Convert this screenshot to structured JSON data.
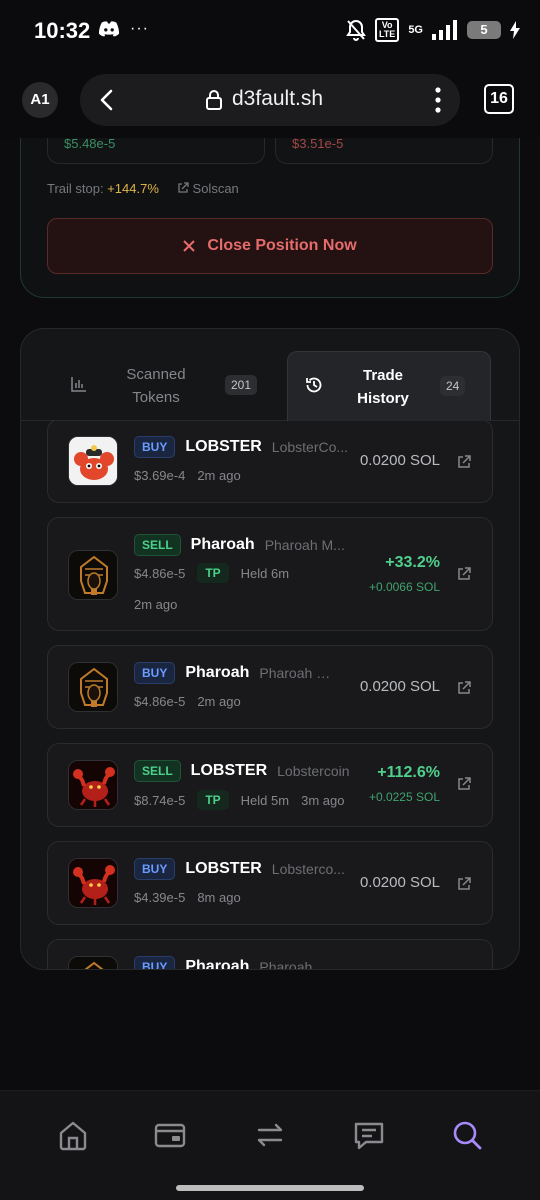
{
  "status_bar": {
    "time": "10:32",
    "volte": "Vo\nLTE",
    "network": "5G",
    "battery": "5"
  },
  "browser": {
    "profile": "A1",
    "url": "d3fault.sh",
    "tabs_count": "16"
  },
  "position": {
    "price_left": "$5.48e-5",
    "price_right": "$3.51e-5",
    "trail_label": "Trail stop:",
    "trail_value": "+144.7%",
    "solscan_label": "Solscan",
    "close_button": "Close Position Now"
  },
  "tabs": {
    "scanned": {
      "label": "Scanned Tokens",
      "count": "201"
    },
    "history": {
      "label": "Trade History",
      "count": "24"
    }
  },
  "trades": [
    {
      "side": "BUY",
      "symbol": "LOBSTER",
      "name": "LobsterCo...",
      "price": "$3.69e-4",
      "time": "2m ago",
      "amount": "0.0200 SOL",
      "icon": "lobster-cartoon"
    },
    {
      "side": "SELL",
      "symbol": "Pharoah",
      "name": "Pharoah M...",
      "price": "$4.86e-5",
      "tp": "TP",
      "held": "Held 6m",
      "time": "2m ago",
      "pct": "+33.2%",
      "sol": "+0.0066 SOL",
      "icon": "pharaoh"
    },
    {
      "side": "BUY",
      "symbol": "Pharoah",
      "name": "Pharoah M...",
      "price": "$4.86e-5",
      "time": "2m ago",
      "amount": "0.0200 SOL",
      "icon": "pharaoh"
    },
    {
      "side": "SELL",
      "symbol": "LOBSTER",
      "name": "Lobstercoin",
      "price": "$8.74e-5",
      "tp": "TP",
      "held": "Held 5m",
      "time": "3m ago",
      "pct": "+112.6%",
      "sol": "+0.0225 SOL",
      "icon": "lobster-red"
    },
    {
      "side": "BUY",
      "symbol": "LOBSTER",
      "name": "Lobsterco...",
      "price": "$4.39e-5",
      "time": "8m ago",
      "amount": "0.0200 SOL",
      "icon": "lobster-red"
    },
    {
      "side": "BUY",
      "symbol": "Pharoah",
      "name": "Pharoah M...",
      "icon": "pharaoh"
    }
  ],
  "nav": [
    "home-icon",
    "wallet-icon",
    "swap-icon",
    "chat-icon",
    "search-icon"
  ],
  "colors": {
    "accent_green": "#4fd08d",
    "accent_red": "#e66b6b",
    "accent_purple": "#a78bfa"
  }
}
